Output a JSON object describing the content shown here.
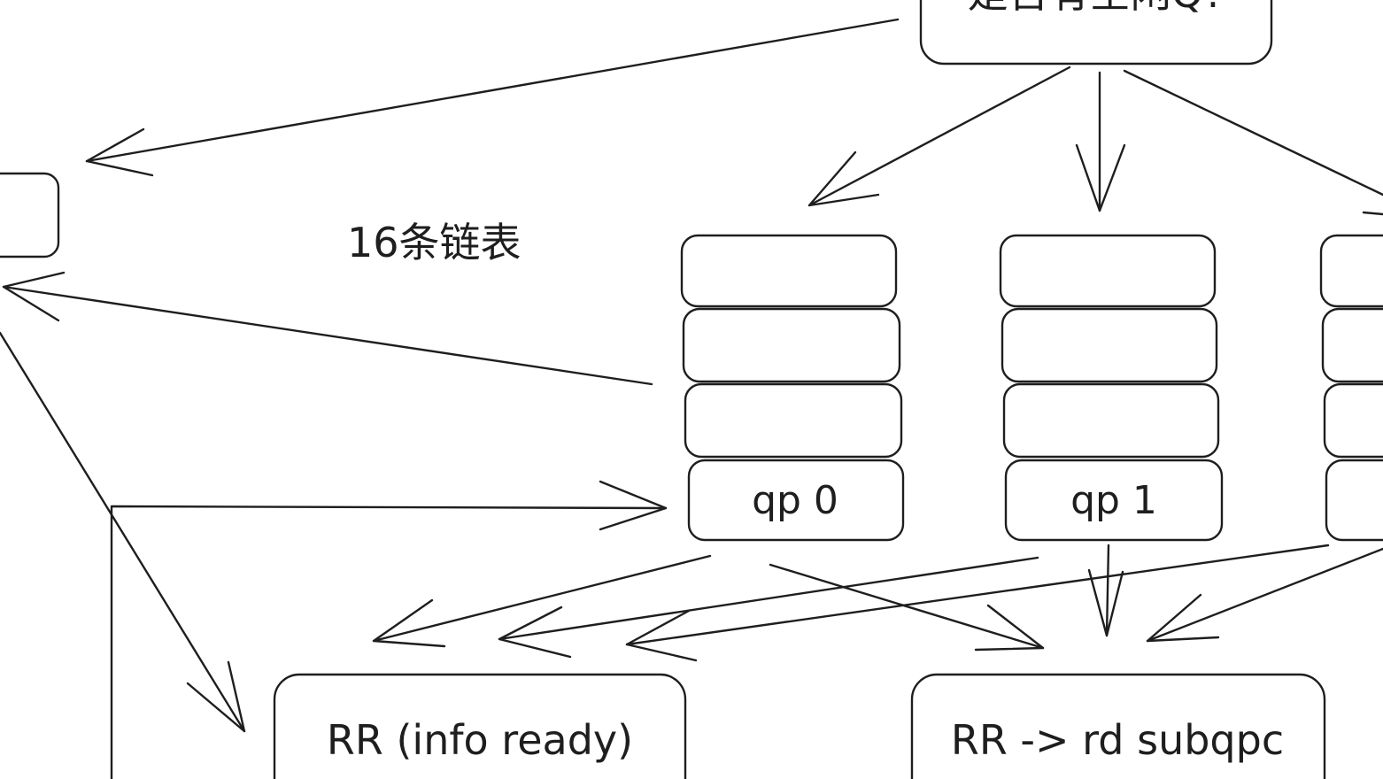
{
  "diagram": {
    "top_box_text": "是否有空闲Q?",
    "list_count_label": "16条链表",
    "queues": [
      {
        "label": "qp 0"
      },
      {
        "label": "qp 1"
      },
      {
        "label": ""
      }
    ],
    "bottom_left_box": "RR (info ready)",
    "bottom_right_box": "RR -> rd subqpc"
  },
  "colors": {
    "stroke": "#1e1e1e",
    "background": "#ffffff"
  }
}
